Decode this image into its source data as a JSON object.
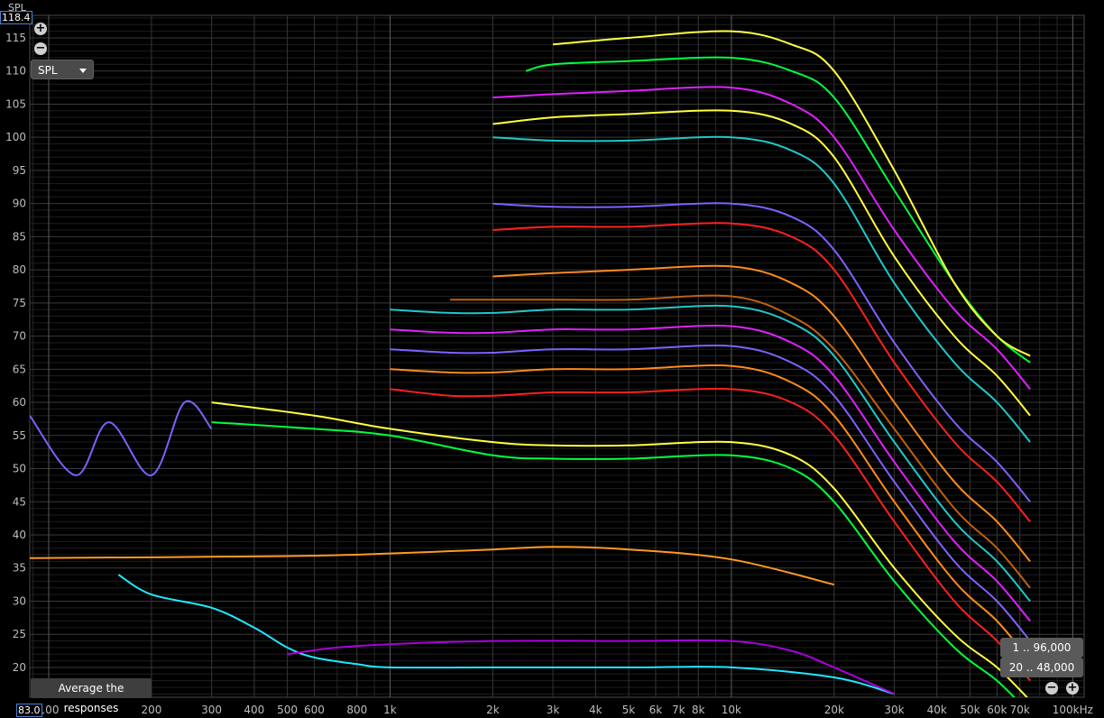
{
  "chart_data": {
    "type": "line",
    "title": "",
    "ylabel": "SPL",
    "xlabel": "",
    "x_scale": "log",
    "xlim": [
      88,
      108000
    ],
    "ylim": [
      15.5,
      118.4
    ],
    "grid": true,
    "legend": "none",
    "x_ticks": [
      {
        "v": 100,
        "label": "100"
      },
      {
        "v": 200,
        "label": "200"
      },
      {
        "v": 300,
        "label": "300"
      },
      {
        "v": 400,
        "label": "400"
      },
      {
        "v": 500,
        "label": "500"
      },
      {
        "v": 600,
        "label": "600"
      },
      {
        "v": 800,
        "label": "800"
      },
      {
        "v": 1000,
        "label": "1k"
      },
      {
        "v": 2000,
        "label": "2k"
      },
      {
        "v": 3000,
        "label": "3k"
      },
      {
        "v": 4000,
        "label": "4k"
      },
      {
        "v": 5000,
        "label": "5k"
      },
      {
        "v": 6000,
        "label": "6k"
      },
      {
        "v": 7000,
        "label": "7k"
      },
      {
        "v": 8000,
        "label": "8k"
      },
      {
        "v": 10000,
        "label": "10k"
      },
      {
        "v": 20000,
        "label": "20k"
      },
      {
        "v": 30000,
        "label": "30k"
      },
      {
        "v": 40000,
        "label": "40k"
      },
      {
        "v": 50000,
        "label": "50k"
      },
      {
        "v": 60000,
        "label": "60k"
      },
      {
        "v": 70000,
        "label": "70k"
      },
      {
        "v": 100000,
        "label": "100kHz"
      }
    ],
    "y_ticks": [
      20,
      25,
      30,
      35,
      40,
      45,
      50,
      55,
      60,
      65,
      70,
      75,
      80,
      85,
      90,
      95,
      100,
      105,
      110,
      115
    ],
    "series": [
      {
        "color": "#ffff40",
        "x": [
          300,
          600,
          1000,
          2000,
          3000,
          5000,
          10000,
          15000,
          20000,
          30000,
          45000,
          60000,
          75000
        ],
        "y": [
          60,
          58,
          56,
          54,
          53.5,
          53.5,
          54,
          52,
          47,
          35,
          25,
          20,
          15
        ]
      },
      {
        "color": "#00ff40",
        "x": [
          300,
          600,
          1000,
          2000,
          3000,
          5000,
          10000,
          15000,
          20000,
          30000,
          45000,
          60000,
          75000
        ],
        "y": [
          57,
          56,
          55,
          52,
          51.5,
          51.5,
          52,
          50,
          45,
          33,
          23,
          18,
          13
        ]
      },
      {
        "color": "#ff2020",
        "x": [
          1000,
          1500,
          2000,
          3000,
          5000,
          10000,
          15000,
          20000,
          30000,
          45000,
          60000,
          75000
        ],
        "y": [
          62,
          61,
          61,
          61.5,
          61.5,
          62,
          60,
          55,
          42,
          30,
          24,
          18
        ]
      },
      {
        "color": "#ff8a1e",
        "x": [
          1000,
          1500,
          2000,
          3000,
          5000,
          10000,
          15000,
          20000,
          30000,
          45000,
          60000,
          75000
        ],
        "y": [
          65,
          64.5,
          64.5,
          65,
          65,
          65.5,
          63,
          58,
          45,
          33,
          27,
          21
        ]
      },
      {
        "color": "#8060ff",
        "x": [
          1000,
          1500,
          2000,
          3000,
          5000,
          10000,
          15000,
          20000,
          30000,
          45000,
          60000,
          75000
        ],
        "y": [
          68,
          67.5,
          67.5,
          68,
          68,
          68.5,
          66,
          61,
          48,
          36,
          30,
          24
        ]
      },
      {
        "color": "#e020ff",
        "x": [
          1000,
          1500,
          2000,
          3000,
          5000,
          10000,
          15000,
          20000,
          30000,
          45000,
          60000,
          75000
        ],
        "y": [
          71,
          70.5,
          70.5,
          71,
          71,
          71.5,
          69,
          64,
          51,
          39,
          33,
          27
        ]
      },
      {
        "color": "#20c8c8",
        "x": [
          1000,
          1500,
          2000,
          3000,
          5000,
          10000,
          15000,
          20000,
          30000,
          45000,
          60000,
          75000
        ],
        "y": [
          74,
          73.5,
          73.5,
          74,
          74,
          74.5,
          72,
          67,
          54,
          42,
          36,
          30
        ]
      },
      {
        "color": "#c06010",
        "x": [
          1500,
          2000,
          3000,
          5000,
          10000,
          15000,
          20000,
          30000,
          45000,
          60000,
          75000
        ],
        "y": [
          75.5,
          75.5,
          75.5,
          75.5,
          76,
          73,
          68,
          56,
          44,
          38,
          32
        ]
      },
      {
        "color": "#ff8a1e",
        "x": [
          2000,
          3000,
          5000,
          10000,
          15000,
          20000,
          30000,
          45000,
          60000,
          75000
        ],
        "y": [
          79,
          79.5,
          80,
          80.5,
          78,
          73,
          60,
          48,
          42,
          36
        ]
      },
      {
        "color": "#ff2020",
        "x": [
          2000,
          3000,
          5000,
          10000,
          15000,
          20000,
          30000,
          45000,
          60000,
          75000
        ],
        "y": [
          86,
          86.5,
          86.5,
          87,
          85,
          80,
          66,
          54,
          48,
          42
        ]
      },
      {
        "color": "#8060ff",
        "x": [
          2000,
          3000,
          5000,
          10000,
          15000,
          20000,
          30000,
          45000,
          60000,
          75000
        ],
        "y": [
          90,
          89.5,
          89.5,
          90,
          88,
          83,
          69,
          57,
          51,
          45
        ]
      },
      {
        "color": "#20c8c8",
        "x": [
          2000,
          3000,
          5000,
          10000,
          15000,
          20000,
          30000,
          45000,
          60000,
          75000
        ],
        "y": [
          100,
          99.5,
          99.5,
          100,
          98,
          93,
          78,
          66,
          60,
          54
        ]
      },
      {
        "color": "#ffff40",
        "x": [
          2000,
          3000,
          5000,
          10000,
          15000,
          20000,
          30000,
          45000,
          60000,
          75000
        ],
        "y": [
          102,
          103,
          103.5,
          104,
          102,
          97,
          82,
          70,
          64,
          58
        ]
      },
      {
        "color": "#e020ff",
        "x": [
          2000,
          3000,
          5000,
          10000,
          15000,
          20000,
          30000,
          45000,
          60000,
          75000
        ],
        "y": [
          106,
          106.5,
          107,
          107.5,
          105,
          100,
          86,
          74,
          68,
          62
        ]
      },
      {
        "color": "#00ff40",
        "x": [
          2500,
          3000,
          5000,
          10000,
          15000,
          20000,
          30000,
          45000,
          60000,
          75000
        ],
        "y": [
          110,
          111,
          111.5,
          112,
          110,
          106,
          92,
          78,
          70,
          66
        ]
      },
      {
        "color": "#ffff40",
        "x": [
          3000,
          5000,
          10000,
          15000,
          20000,
          30000,
          45000,
          60000,
          75000
        ],
        "y": [
          114,
          115,
          116,
          114,
          110,
          95,
          78,
          70,
          67
        ]
      },
      {
        "color": "#ff9a20",
        "x": [
          88,
          500,
          1000,
          2000,
          3000,
          5000,
          10000,
          20000
        ],
        "y": [
          36.5,
          36.8,
          37.2,
          37.8,
          38.2,
          37.8,
          36.3,
          32.5
        ]
      },
      {
        "color": "#20e8ff",
        "x": [
          160,
          200,
          300,
          400,
          500,
          600,
          800,
          1000,
          2000,
          5000,
          10000,
          20000,
          30000
        ],
        "y": [
          34,
          31,
          29,
          26,
          23,
          21.5,
          20.5,
          20,
          20,
          20,
          20,
          18.5,
          16
        ]
      },
      {
        "color": "#aa00dd",
        "x": [
          500,
          700,
          1000,
          2000,
          5000,
          10000,
          15000,
          20000,
          30000
        ],
        "y": [
          22,
          23,
          23.5,
          24,
          24,
          24,
          22.5,
          20,
          16
        ]
      },
      {
        "color": "#8060ff",
        "x": [
          88,
          120,
          150,
          200,
          250,
          300
        ],
        "y": [
          58,
          49,
          57,
          49,
          60,
          56
        ]
      }
    ]
  },
  "ui": {
    "y_axis_name": "SPL",
    "y_max_box": "118.4",
    "y_min_box": "83.0",
    "mode_select": "SPL",
    "range_1": "1 .. 96,000",
    "range_2": "20 .. 48,000",
    "average_button": "Average the responses",
    "zoom_in_symbol": "+",
    "zoom_out_symbol": "−"
  }
}
